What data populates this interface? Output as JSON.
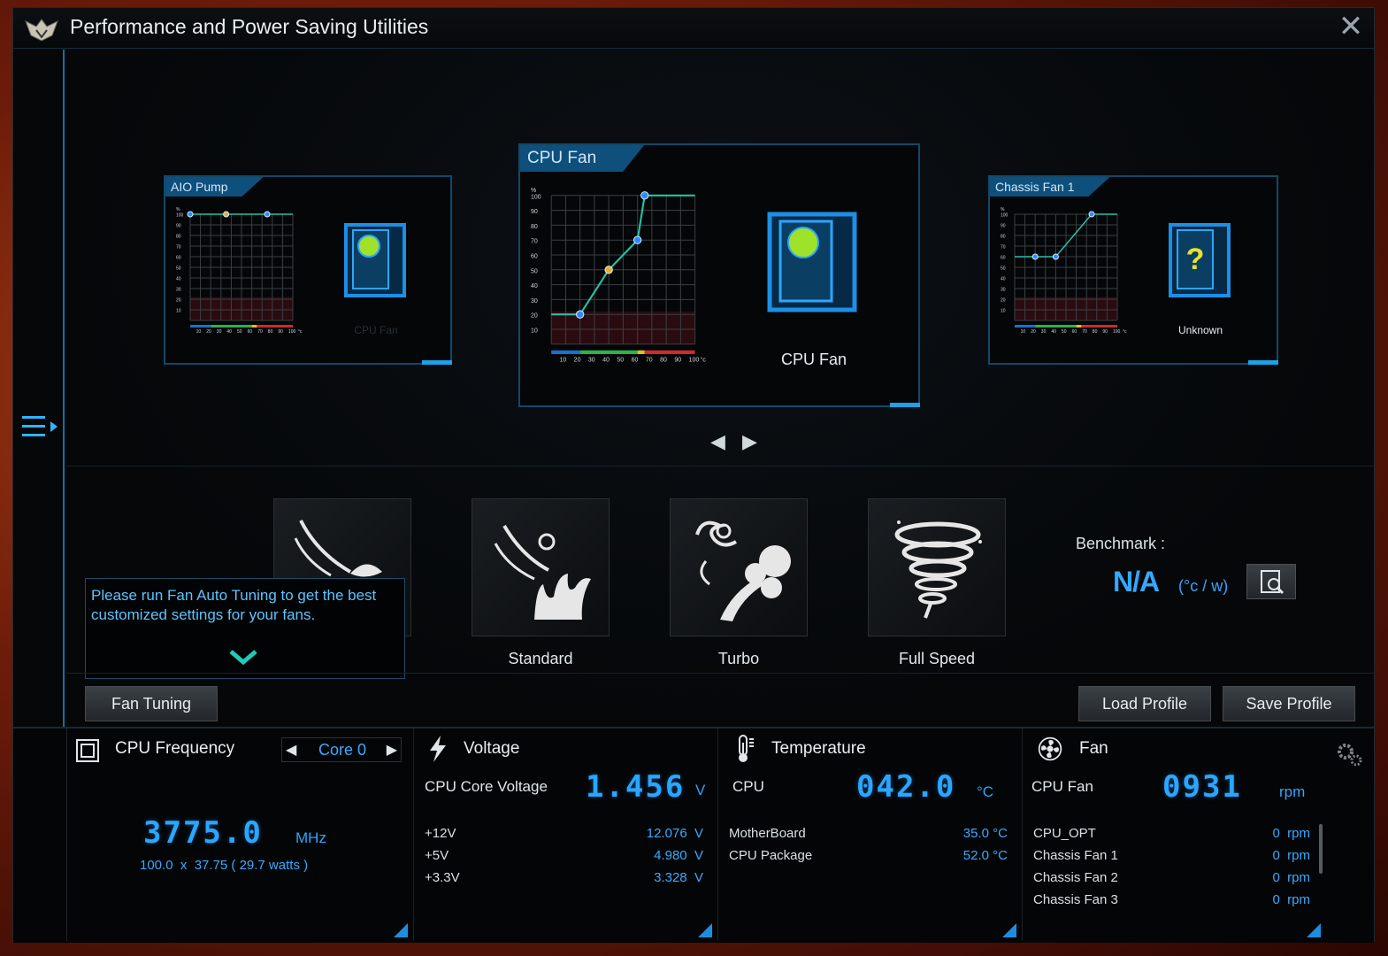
{
  "window": {
    "title": "Performance and Power Saving Utilities"
  },
  "fan_cards": {
    "left": {
      "caption": "AIO Pump",
      "case_label": "CPU Fan",
      "y_ticks": [
        "%",
        "100",
        "90",
        "80",
        "70",
        "60",
        "50",
        "40",
        "30",
        "20",
        "10"
      ],
      "x_ticks": [
        "10",
        "20",
        "30",
        "40",
        "50",
        "60",
        "70",
        "80",
        "90",
        "100",
        "°c"
      ]
    },
    "center": {
      "caption": "CPU Fan",
      "case_label": "CPU Fan",
      "y_ticks": [
        "%",
        "100",
        "90",
        "80",
        "70",
        "60",
        "50",
        "40",
        "30",
        "20",
        "10"
      ],
      "x_ticks": [
        "10",
        "20",
        "30",
        "40",
        "50",
        "60",
        "70",
        "80",
        "90",
        "100",
        "°c"
      ]
    },
    "right": {
      "caption": "Chassis Fan 1",
      "case_label": "Unknown",
      "y_ticks": [
        "%",
        "100",
        "90",
        "80",
        "70",
        "60",
        "50",
        "40",
        "30",
        "20",
        "10"
      ],
      "x_ticks": [
        "10",
        "20",
        "30",
        "40",
        "50",
        "60",
        "70",
        "80",
        "90",
        "100",
        "°c"
      ]
    }
  },
  "modes": {
    "standard": "Standard",
    "turbo": "Turbo",
    "full_speed": "Full Speed"
  },
  "tooltip": {
    "text": "Please run Fan Auto Tuning to get the best customized settings for your fans."
  },
  "benchmark": {
    "label": "Benchmark :",
    "value": "N/A",
    "unit": "(°c / w)"
  },
  "buttons": {
    "fan_tuning": "Fan Tuning",
    "load_profile": "Load Profile",
    "save_profile": "Save Profile"
  },
  "cpu_frequency": {
    "title": "CPU Frequency",
    "core_select": "Core 0",
    "value": "3775.0",
    "unit": "MHz",
    "detail": "100.0  x  37.75 ( 29.7 watts )"
  },
  "voltage": {
    "title": "Voltage",
    "main_label": "CPU Core Voltage",
    "main_value": "1.456",
    "main_unit": "V",
    "rows": [
      {
        "label": "+12V",
        "value": "12.076  V"
      },
      {
        "label": "+5V",
        "value": "4.980  V"
      },
      {
        "label": "+3.3V",
        "value": "3.328  V"
      }
    ]
  },
  "temperature": {
    "title": "Temperature",
    "main_label": "CPU",
    "main_value": "042.0",
    "main_unit": "°C",
    "rows": [
      {
        "label": "MotherBoard",
        "value": "35.0 °C"
      },
      {
        "label": "CPU Package",
        "value": "52.0 °C"
      }
    ]
  },
  "fan": {
    "title": "Fan",
    "main_label": "CPU Fan",
    "main_value": "0931",
    "main_unit": "rpm",
    "rows": [
      {
        "label": "CPU_OPT",
        "value": "0  rpm"
      },
      {
        "label": "Chassis Fan 1",
        "value": "0  rpm"
      },
      {
        "label": "Chassis Fan 2",
        "value": "0  rpm"
      },
      {
        "label": "Chassis Fan 3",
        "value": "0  rpm"
      }
    ]
  },
  "colors": {
    "accent": "#2aa6ff",
    "frame": "#1a6fa0"
  }
}
